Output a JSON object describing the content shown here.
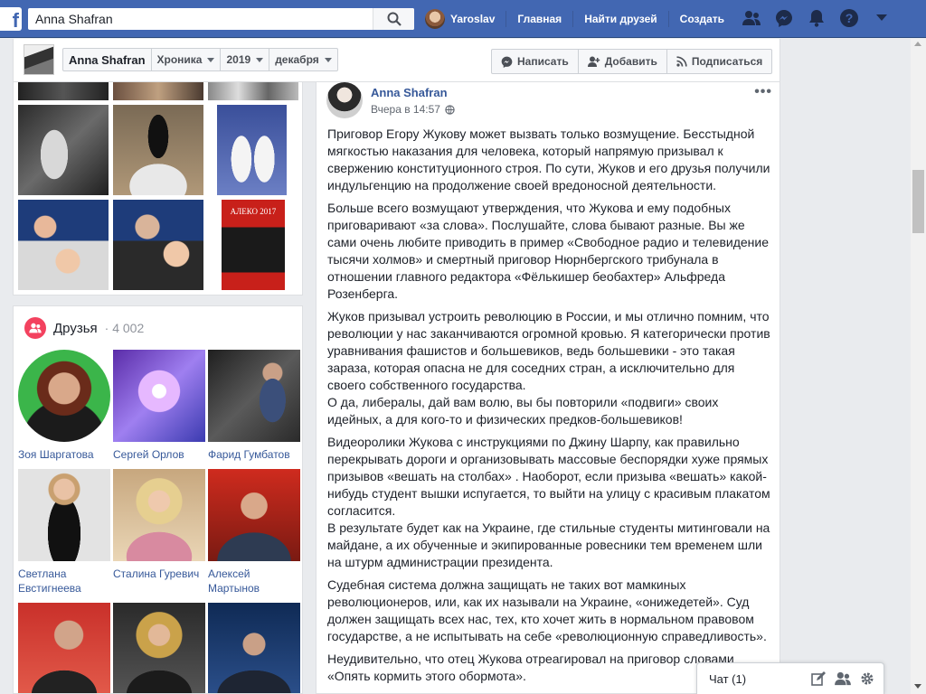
{
  "topbar": {
    "logo": "f",
    "search_value": "Anna Shafran",
    "user_name": "Yaroslav",
    "nav_items": [
      "Главная",
      "Найти друзей",
      "Создать"
    ],
    "icons": [
      "friend-requests-icon",
      "messenger-icon",
      "notifications-icon",
      "help-icon",
      "menu-caret-icon"
    ],
    "brand_color": "#4267b2"
  },
  "subheader": {
    "profile_name": "Anna Shafran",
    "timeline": "Хроника",
    "year": "2019",
    "month": "декабря",
    "write": "Написать",
    "add": "Добавить",
    "follow": "Подписаться"
  },
  "friends": {
    "title": "Друзья",
    "count": "· 4 002",
    "list": [
      {
        "name": "Зоя Шаргатова"
      },
      {
        "name": "Сергей Орлов"
      },
      {
        "name": "Фарид Гумбатов"
      },
      {
        "name": "Светлана Евстигнеева"
      },
      {
        "name": "Сталина Гуревич"
      },
      {
        "name": "Алексей Мартынов"
      },
      {
        "name": ""
      },
      {
        "name": ""
      },
      {
        "name": ""
      }
    ]
  },
  "photos": {
    "book_title": "АЛЕКО 2017"
  },
  "post": {
    "author": "Anna Shafran",
    "time": "Вчера в 14:57",
    "paragraphs": [
      "Приговор Егору Жукову может вызвать только возмущение. Бесстыдной мягкостью наказания для человека, который напрямую призывал к свержению конституционного строя. По сути, Жуков и его друзья получили индульгенцию на продолжение своей вредоносной деятельности.",
      "Больше всего возмущают утверждения, что Жукова и ему подобных приговаривают «за слова». Послушайте, слова бывают разные. Вы же сами очень любите приводить в пример «Свободное радио и телевидение тысячи холмов» и смертный приговор Нюрнбергского трибунала в отношении главного редактора «Фёлькишер беобахтер» Альфреда Розенберга.",
      "Жуков призывал устроить революцию в России, и мы отлично помним, что революции у нас заканчиваются огромной кровью. Я категорически против уравнивания фашистов и большевиков, ведь большевики - это такая зараза, которая опасна не для соседних стран, а исключительно для своего собственного государства.\nО да, либералы, дай вам волю, вы бы повторили «подвиги» своих идейных, а для кого-то и физических предков-большевиков!",
      "Видеоролики Жукова с инструкциями по Джину Шарпу, как правильно перекрывать дороги и организовывать массовые беспорядки хуже прямых призывов «вешать на столбах» . Наоборот, если призыва «вешать» какой-нибудь студент вышки испугается, то выйти на улицу с красивым плакатом согласится.\nВ результате будет как на Украине, где стильные студенты митинговали на майдане, а их обученные и экипированные ровесники тем временем шли на штурм администрации президента.",
      "Судебная система должна защищать не таких вот мамкиных революционеров, или, как их называли на Украине, «онижедетей». Суд должен защищать всех нас, тех, кто хочет жить в нормальном правовом государстве, а не испытывать на себе «революционную справедливость».",
      "Неудивительно, что отец Жукова отреагировал на приговор словами «Опять кормить этого обормота»."
    ]
  },
  "chat": {
    "label": "Чат (1)"
  }
}
